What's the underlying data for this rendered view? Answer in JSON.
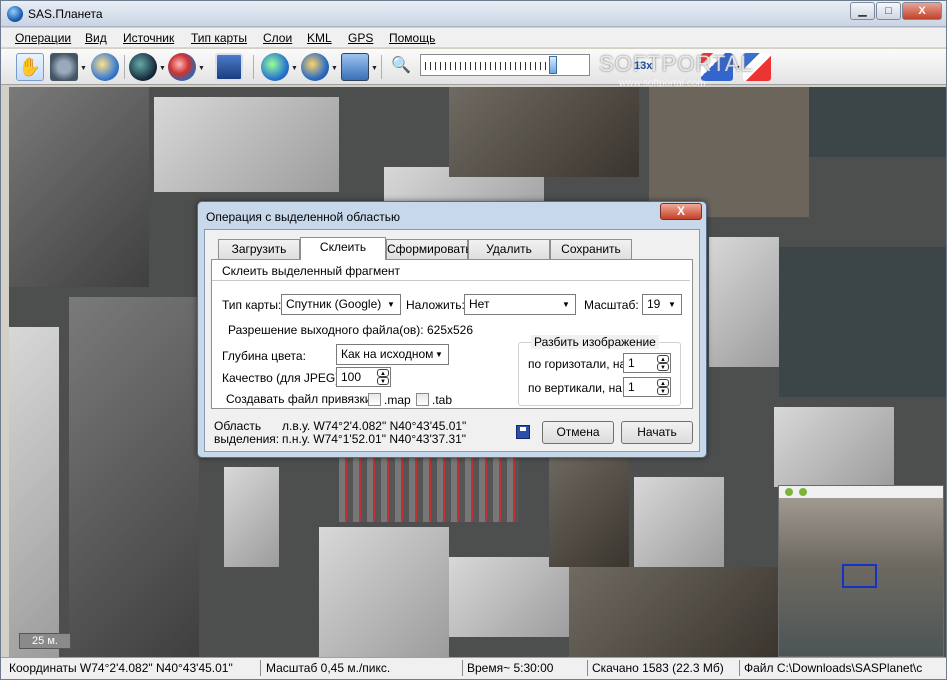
{
  "app": {
    "title": "SAS.Планета"
  },
  "window_buttons": {
    "minimize": "▁",
    "maximize": "□",
    "close": "X"
  },
  "menu": [
    "Операции",
    "Вид",
    "Источник",
    "Тип карты",
    "Слои",
    "KML",
    "GPS",
    "Помощь"
  ],
  "toolbar": {
    "zoom_level": "13x",
    "watermark": "SOFTPORTAL",
    "watermark_url": "www.softportal.com"
  },
  "map": {
    "scale_label": "25 м."
  },
  "status": {
    "coordinates": "Координаты W74°2'4.082\" N40°43'45.01\"",
    "scale": "Масштаб 0,45 м./пикс.",
    "time": "Время~ 5:30:00",
    "downloaded": "Скачано 1583 (22.3 Мб)",
    "file": "Файл C:\\Downloads\\SASPlanet\\c"
  },
  "dialog": {
    "title": "Операция с выделенной областью",
    "close": "X",
    "tabs": [
      "Загрузить",
      "Склеить",
      "Сформировать",
      "Удалить",
      "Сохранить"
    ],
    "active_tab": "Склеить",
    "section_title": "Склеить выделенный фрагмент",
    "map_type_label": "Тип карты:",
    "map_type_value": "Спутник (Google)",
    "overlay_label": "Наложить:",
    "overlay_value": "Нет",
    "zoom_label": "Масштаб:",
    "zoom_value": "19",
    "resolution_text": "Разрешение выходного файла(ов): 625x526",
    "color_depth_label": "Глубина цвета:",
    "color_depth_value": "Как на исходном",
    "quality_label": "Качество (для JPEG):",
    "quality_value": "100",
    "binding_label": "Создавать файл привязки",
    "map_ext": ".map",
    "tab_ext": ".tab",
    "split_group_label": "Разбить изображение",
    "split_h_label": "по горизотали, на",
    "split_h_value": "1",
    "split_v_label": "по вертикали, на",
    "split_v_value": "1",
    "area_label": "Область",
    "selection_label": "выделения:",
    "coord_top_left": "л.в.у. W74°2'4.082\" N40°43'45.01\"",
    "coord_bottom_right": "п.н.у. W74°1'52.01\" N40°43'37.31\"",
    "cancel": "Отмена",
    "start": "Начать"
  },
  "colors": {
    "title_bar": "#c9d4e3",
    "dialog_frame": "#c7d8ea",
    "close_red": "#c43f27"
  }
}
